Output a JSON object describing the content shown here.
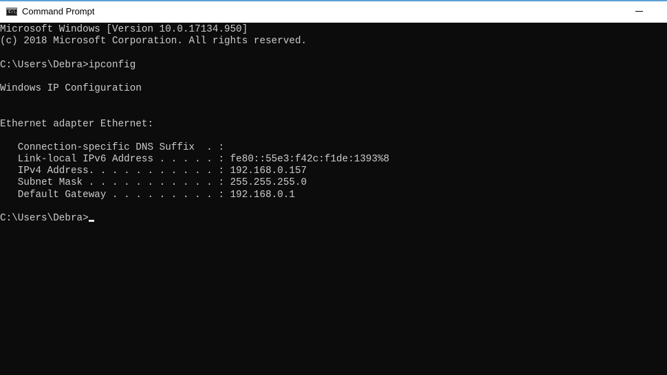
{
  "window": {
    "title": "Command Prompt",
    "icon": "cmd-icon",
    "icon_text": "C:\\.",
    "controls": {
      "minimize_icon": "minimize-icon"
    }
  },
  "console": {
    "lines": [
      "Microsoft Windows [Version 10.0.17134.950]",
      "(c) 2018 Microsoft Corporation. All rights reserved.",
      "",
      "C:\\Users\\Debra>ipconfig",
      "",
      "Windows IP Configuration",
      "",
      "",
      "Ethernet adapter Ethernet:",
      "",
      "   Connection-specific DNS Suffix  . :",
      "   Link-local IPv6 Address . . . . . : fe80::55e3:f42c:f1de:1393%8",
      "   IPv4 Address. . . . . . . . . . . : 192.168.0.157",
      "   Subnet Mask . . . . . . . . . . . : 255.255.255.0",
      "   Default Gateway . . . . . . . . . : 192.168.0.1",
      ""
    ],
    "prompt": "C:\\Users\\Debra>",
    "input_value": ""
  },
  "colors": {
    "console_background": "#0c0c0c",
    "console_text": "#cccccc",
    "titlebar_background": "#ffffff",
    "titlebar_accent": "#5aa0d8"
  }
}
